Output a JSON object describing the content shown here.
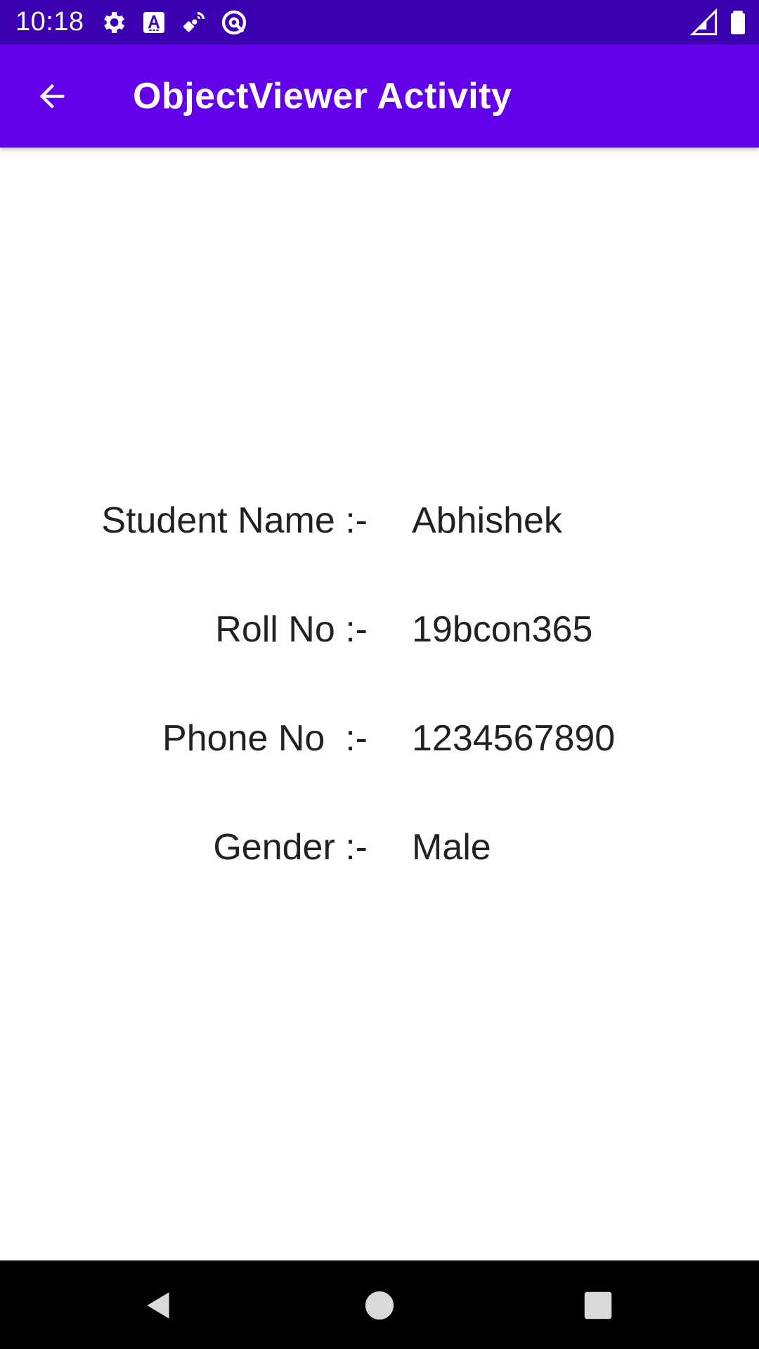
{
  "status_bar": {
    "time": "10:18",
    "icons": [
      "gear-icon",
      "text-a-icon",
      "satellite-icon",
      "at-sign-icon",
      "cell-signal-icon",
      "battery-icon"
    ]
  },
  "app_bar": {
    "title": "ObjectViewer Activity",
    "back_icon": "arrow-back-icon"
  },
  "student": {
    "fields": [
      {
        "label": "Student Name :-",
        "value": "Abhishek"
      },
      {
        "label": "Roll No :-",
        "value": "19bcon365"
      },
      {
        "label": "Phone No  :-",
        "value": "1234567890"
      },
      {
        "label": "Gender :-",
        "value": "Male"
      }
    ]
  },
  "nav_bar": {
    "icons": [
      "back-triangle-icon",
      "home-circle-icon",
      "recents-square-icon"
    ]
  },
  "colors": {
    "status_bar": "#3d00b0",
    "app_bar": "#6200ea",
    "text": "#202124",
    "nav_bar": "#000000"
  }
}
